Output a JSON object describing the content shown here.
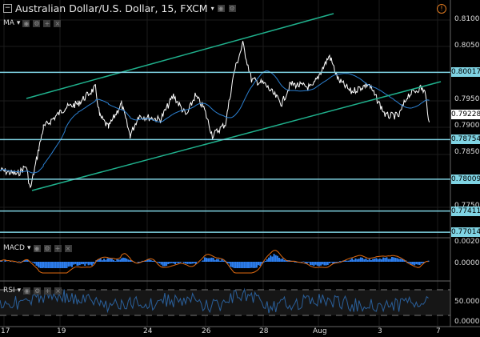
{
  "header": {
    "title": "Australian Dollar/U.S. Dollar, 15, FXCM",
    "alert_icon": "!"
  },
  "indicators": {
    "ma": "MA",
    "macd": "MACD",
    "rsi": "RSI"
  },
  "price_axis": [
    "0.81000",
    "0.80500",
    "0.79500",
    "0.79000",
    "0.78500",
    "0.77500"
  ],
  "price_levels": [
    0.81,
    0.805,
    0.795,
    0.79,
    0.785,
    0.775
  ],
  "horizontal_lines": [
    {
      "label": "0.80017",
      "value": 0.80017
    },
    {
      "label": "0.78754",
      "value": 0.78754
    },
    {
      "label": "0.78009",
      "value": 0.78009
    },
    {
      "label": "0.77411",
      "value": 0.77411
    },
    {
      "label": "0.77014",
      "value": 0.77014
    }
  ],
  "last_price": {
    "label": "0.79228",
    "value": 0.79228
  },
  "macd_axis": [
    "0.0020",
    "0.0000"
  ],
  "rsi_axis": [
    "50.0000",
    "0.0000"
  ],
  "x_axis": [
    "17",
    "19",
    "24",
    "26",
    "28",
    "Aug",
    "3",
    "7"
  ],
  "colors": {
    "bg": "#000000",
    "price": "#ffffff",
    "ma": "#2b7fd0",
    "channel": "#1fb08c",
    "level": "#7fd3e3",
    "macd": "#e06a10",
    "hist": "#2d7ff0",
    "rsi": "#2a5f9a"
  },
  "chart_data": {
    "type": "line",
    "series": [
      {
        "name": "AUDUSD",
        "points": [
          [
            0,
            0.7818
          ],
          [
            4,
            0.781
          ],
          [
            6,
            0.7826
          ],
          [
            7,
            0.7782
          ],
          [
            9,
            0.786
          ],
          [
            10,
            0.7898
          ],
          [
            15,
            0.7935
          ],
          [
            18,
            0.7943
          ],
          [
            22,
            0.7973
          ],
          [
            23,
            0.792
          ],
          [
            25,
            0.7898
          ],
          [
            28,
            0.7943
          ],
          [
            30,
            0.7883
          ],
          [
            32,
            0.792
          ],
          [
            37,
            0.7913
          ],
          [
            40,
            0.7958
          ],
          [
            43,
            0.792
          ],
          [
            45,
            0.7958
          ],
          [
            47,
            0.7935
          ],
          [
            49,
            0.7883
          ],
          [
            52,
            0.7905
          ],
          [
            54,
            0.8003
          ],
          [
            56,
            0.8055
          ],
          [
            58,
            0.7988
          ],
          [
            61,
            0.798
          ],
          [
            65,
            0.7943
          ],
          [
            67,
            0.798
          ],
          [
            72,
            0.7973
          ],
          [
            76,
            0.8033
          ],
          [
            78,
            0.7988
          ],
          [
            81,
            0.7965
          ],
          [
            85,
            0.798
          ],
          [
            89,
            0.792
          ],
          [
            92,
            0.792
          ],
          [
            94,
            0.7958
          ],
          [
            97,
            0.7973
          ],
          [
            98,
            0.7965
          ],
          [
            99,
            0.7908
          ]
        ]
      }
    ]
  }
}
